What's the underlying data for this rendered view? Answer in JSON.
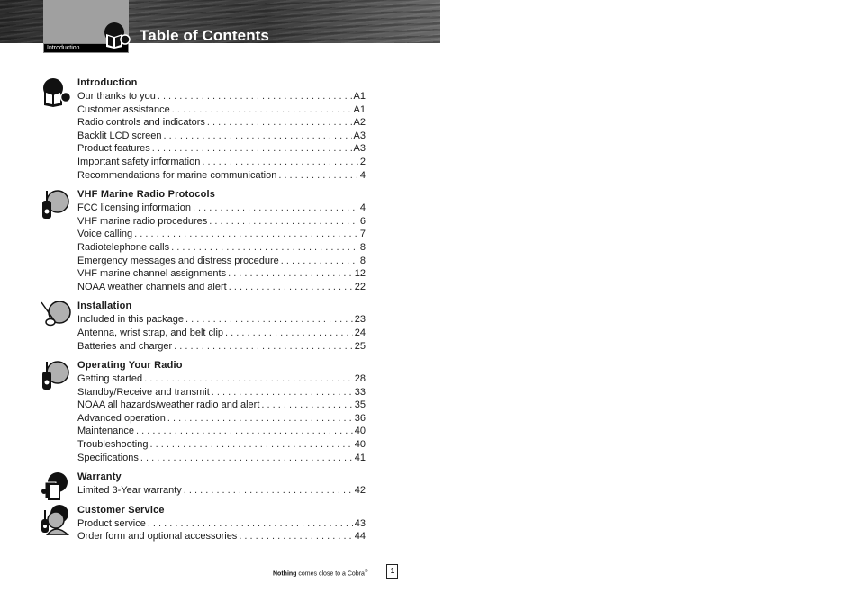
{
  "header": {
    "tab_label": "Introduction",
    "title": "Table of Contents",
    "icon": "book-reader-icon"
  },
  "sections": [
    {
      "title": "Introduction",
      "icon": "book-reader-icon",
      "entries": [
        {
          "label": "Our thanks to you",
          "page": "A1"
        },
        {
          "label": "Customer assistance",
          "page": "A1"
        },
        {
          "label": "Radio controls and indicators",
          "page": "A2"
        },
        {
          "label": "Backlit LCD screen",
          "page": "A3"
        },
        {
          "label": "Product features",
          "page": "A3"
        },
        {
          "label": "Important safety information",
          "page": "2"
        },
        {
          "label": "Recommendations for marine communication",
          "page": "4"
        }
      ]
    },
    {
      "title": "VHF Marine Radio Protocols",
      "icon": "handheld-radio-icon",
      "entries": [
        {
          "label": "FCC licensing information",
          "page": "4"
        },
        {
          "label": "VHF marine radio procedures",
          "page": "6"
        },
        {
          "label": "Voice calling",
          "page": "7"
        },
        {
          "label": "Radiotelephone calls",
          "page": "8"
        },
        {
          "label": "Emergency messages and distress procedure",
          "page": "8"
        },
        {
          "label": "VHF marine channel assignments",
          "page": "12"
        },
        {
          "label": "NOAA weather channels and alert",
          "page": "22"
        }
      ]
    },
    {
      "title": "Installation",
      "icon": "antenna-icon",
      "entries": [
        {
          "label": "Included in this package",
          "page": "23"
        },
        {
          "label": "Antenna, wrist strap, and belt clip",
          "page": "24"
        },
        {
          "label": "Batteries and charger",
          "page": "25"
        }
      ]
    },
    {
      "title": "Operating Your Radio",
      "icon": "handheld-radio-icon",
      "entries": [
        {
          "label": "Getting started",
          "page": "28"
        },
        {
          "label": "Standby/Receive and transmit",
          "page": "33"
        },
        {
          "label": "NOAA all hazards/weather radio and alert",
          "page": "35"
        },
        {
          "label": "Advanced operation",
          "page": "36"
        },
        {
          "label": "Maintenance",
          "page": "40"
        },
        {
          "label": "Troubleshooting",
          "page": "40"
        },
        {
          "label": "Specifications",
          "page": "41"
        }
      ]
    },
    {
      "title": "Warranty",
      "icon": "warranty-document-icon",
      "entries": [
        {
          "label": "Limited 3-Year warranty",
          "page": "42"
        }
      ]
    },
    {
      "title": "Customer Service",
      "icon": "customer-service-icon",
      "entries": [
        {
          "label": "Product service",
          "page": "43"
        },
        {
          "label": "Order form and optional accessories",
          "page": "44"
        }
      ]
    }
  ],
  "footer": {
    "tagline_bold": "Nothing",
    "tagline_rest": " comes close to a Cobra",
    "trademark": "®",
    "page_number": "1"
  }
}
